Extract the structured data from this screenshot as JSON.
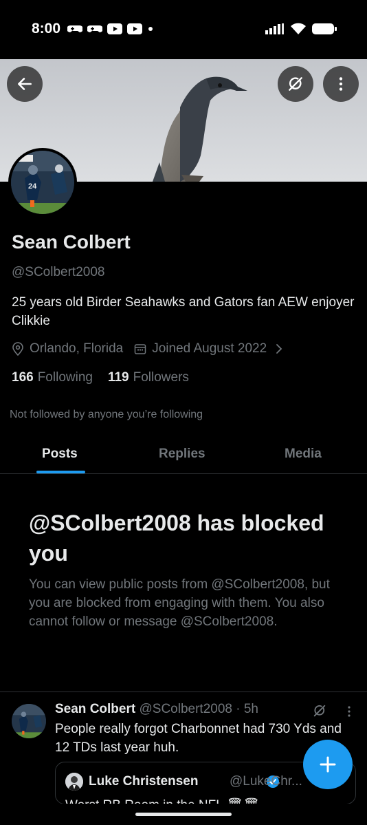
{
  "status_bar": {
    "time": "8:00",
    "icons_left": [
      "game-controller-icon",
      "game-controller-icon",
      "youtube-icon",
      "youtube-icon",
      "dot-icon"
    ],
    "icons_right": [
      "signal-icon",
      "wifi-icon",
      "battery-icon"
    ]
  },
  "header": {
    "back_icon": "arrow-left-icon",
    "grok_icon": "grok-icon",
    "more_icon": "more-vertical-icon"
  },
  "profile": {
    "name": "Sean Colbert",
    "handle": "@SColbert2008",
    "bio": "25 years old Birder Seahawks and Gators fan AEW enjoyer Clikkie",
    "location": "Orlando, Florida",
    "joined": "Joined August 2022",
    "following_count": "166",
    "following_label": "Following",
    "followers_count": "119",
    "followers_label": "Followers",
    "not_followed": "Not followed by anyone you’re following"
  },
  "tabs": [
    {
      "label": "Posts",
      "active": true
    },
    {
      "label": "Replies",
      "active": false
    },
    {
      "label": "Media",
      "active": false
    }
  ],
  "blocked": {
    "title": "@SColbert2008 has blocked you",
    "description": "You can view public posts from @SColbert2008, but you are blocked from engaging with them. You also cannot follow or message @SColbert2008."
  },
  "post": {
    "name": "Sean Colbert",
    "handle_time": "@SColbert2008 · 5h",
    "text": "People really forgot Charbonnet had 730 Yds and 12 TDs last year huh.",
    "quote": {
      "name": "Luke Christensen",
      "handle": "@LukeChr...",
      "text": "Worst RB Room in the NFL 🗑🗑"
    }
  },
  "colors": {
    "accent": "#1d9bf0",
    "background": "#000000",
    "secondary_text": "#71767b",
    "primary_text": "#e7e9ea"
  }
}
